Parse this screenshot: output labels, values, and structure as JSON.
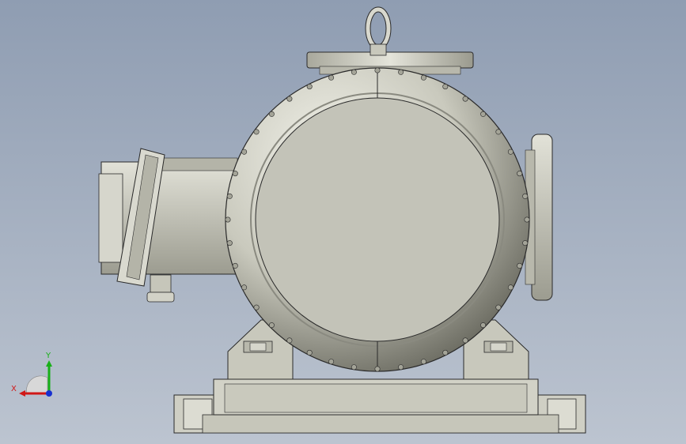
{
  "viewport": {
    "background_top": "#8f9db2",
    "background_bottom": "#bcc4d0"
  },
  "model": {
    "body_fill": "#c8c8bc",
    "face_fill": "#c3c3b8",
    "edge_color": "#2a2a2a"
  },
  "triad": {
    "x_label": "X",
    "y_label": "Y",
    "x_color": "#d01818",
    "y_color": "#18b018",
    "z_color": "#1830d0"
  }
}
